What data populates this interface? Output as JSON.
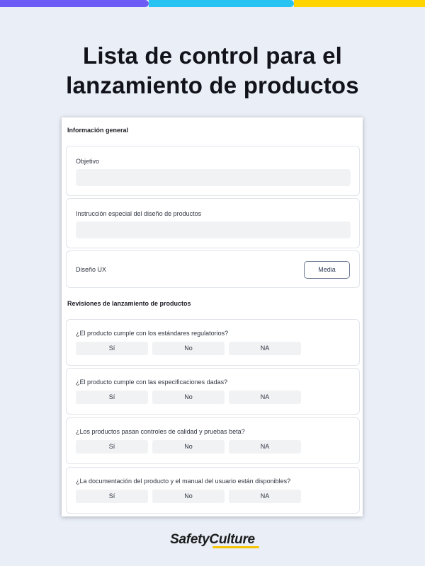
{
  "colors": {
    "stripe_purple": "#6c5cf5",
    "stripe_cyan": "#27c3f3",
    "stripe_yellow": "#ffd400",
    "background": "#e9eef7",
    "brand_accent": "#f4c400"
  },
  "headline": {
    "line1": "Lista de control para el",
    "line2": "lanzamiento de productos"
  },
  "form": {
    "section_general": "Información general",
    "objective_label": "Objetivo",
    "objective_value": "",
    "design_instruction_label": "Instrucción especial del diseño de productos",
    "design_instruction_value": "",
    "ux_label": "Diseño UX",
    "media_button": "Media",
    "section_reviews": "Revisiones de lanzamiento de productos",
    "questions": [
      {
        "text": "¿El producto cumple con los estándares regulatorios?",
        "options": [
          "Sí",
          "No",
          "NA"
        ]
      },
      {
        "text": "¿El producto cumple con las especificaciones dadas?",
        "options": [
          "Sí",
          "No",
          "NA"
        ]
      },
      {
        "text": "¿Los productos pasan controles de calidad y pruebas beta?",
        "options": [
          "Sí",
          "No",
          "NA"
        ]
      },
      {
        "text": "¿La documentación del producto y el manual del usuario están disponibles?",
        "options": [
          "Sí",
          "No",
          "NA"
        ]
      }
    ]
  },
  "brand": {
    "name": "SafetyCulture"
  }
}
